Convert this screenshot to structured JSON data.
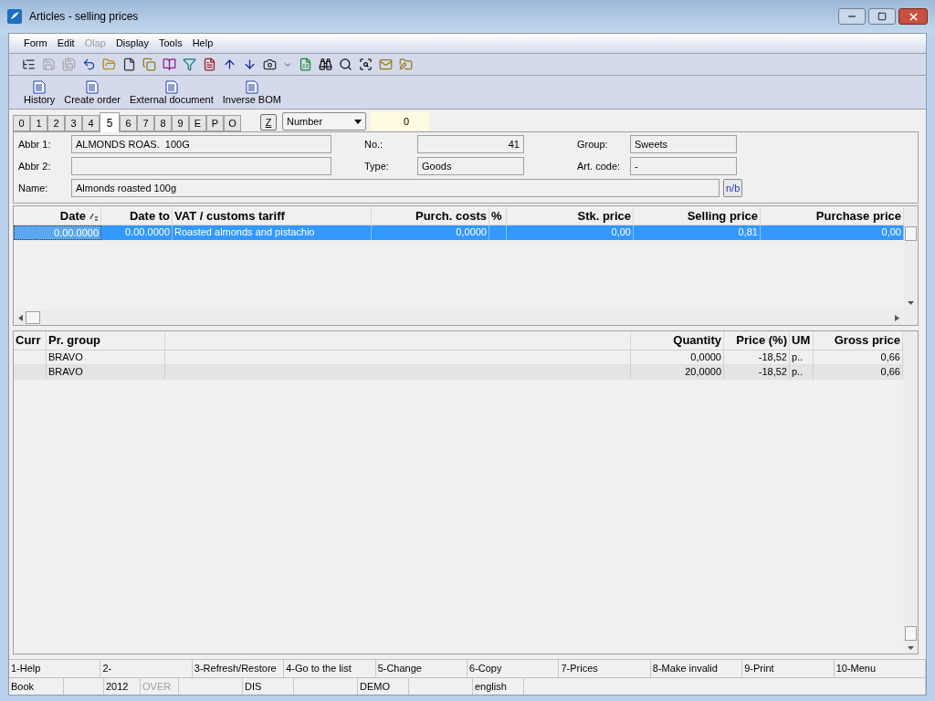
{
  "window": {
    "title": "Articles - selling prices"
  },
  "menu": [
    {
      "label": "Form",
      "disabled": false
    },
    {
      "label": "Edit",
      "disabled": false
    },
    {
      "label": "Olap",
      "disabled": true
    },
    {
      "label": "Display",
      "disabled": false
    },
    {
      "label": "Tools",
      "disabled": false
    },
    {
      "label": "Help",
      "disabled": false
    }
  ],
  "toolbar": [
    {
      "disabled": false
    },
    {
      "disabled": true
    },
    {
      "disabled": true
    },
    {
      "disabled": false
    },
    {
      "disabled": false
    },
    {
      "disabled": false
    },
    {
      "disabled": false
    },
    {
      "disabled": false
    },
    {
      "disabled": false
    },
    {
      "disabled": false
    },
    {
      "disabled": false
    },
    {
      "disabled": false
    },
    {
      "disabled": false
    },
    {
      "disabled": false
    },
    {
      "disabled": false
    },
    {
      "disabled": false
    },
    {
      "disabled": false
    },
    {
      "disabled": false
    }
  ],
  "actions": [
    "History",
    "Create order",
    "External document",
    "Inverse BOM"
  ],
  "tabs": [
    {
      "label": "0",
      "selected": false
    },
    {
      "label": "1",
      "selected": false
    },
    {
      "label": "2",
      "selected": false
    },
    {
      "label": "3",
      "selected": false
    },
    {
      "label": "4",
      "selected": false
    },
    {
      "label": "5",
      "selected": true
    },
    {
      "label": "6",
      "selected": false
    },
    {
      "label": "7",
      "selected": false
    },
    {
      "label": "8",
      "selected": false
    },
    {
      "label": "9",
      "selected": false
    },
    {
      "label": "E",
      "selected": false
    },
    {
      "label": "P",
      "selected": false
    },
    {
      "label": "O",
      "selected": false
    }
  ],
  "filter": {
    "button": "Z",
    "field": "Number",
    "value": "0"
  },
  "form": {
    "abbr1": {
      "label": "Abbr 1:",
      "value": "ALMONDS ROAS.  100G"
    },
    "abbr2": {
      "label": "Abbr 2:"
    },
    "name": {
      "label": "Name:",
      "value": "Almonds roasted 100g"
    },
    "no": {
      "label": "No.:",
      "value": "41"
    },
    "type": {
      "label": "Type:",
      "value": "Goods"
    },
    "group": {
      "label": "Group:",
      "value": "Sweets"
    },
    "art_code": {
      "label": "Art. code:",
      "value": "-"
    },
    "nb_button": "n/b"
  },
  "prices_table": {
    "columns": [
      "Date",
      "Date to",
      "VAT / customs tariff",
      "Purch. costs",
      "%",
      "Stk. price",
      "Selling price",
      "Purchase price"
    ],
    "rows": [
      {
        "selected": true,
        "cells": [
          "0.00.0000",
          "0.00.0000",
          "Roasted almonds and pistachio",
          "0,0000",
          "",
          "0,00",
          "0,81",
          "0,00"
        ]
      }
    ]
  },
  "groups_table": {
    "columns": [
      "Curr",
      "Pr. group",
      "",
      "Quantity",
      "Price (%)",
      "UM",
      "Gross price"
    ],
    "rows": [
      {
        "cells": [
          "",
          "BRAVO",
          "",
          "0,0000",
          "-18,52",
          "p..",
          "0,66"
        ]
      },
      {
        "cells": [
          "",
          "BRAVO",
          "",
          "20,0000",
          "-18,52",
          "p..",
          "0,66"
        ]
      }
    ]
  },
  "function_keys": [
    "1-Help",
    "2-",
    "3-Refresh/Restore",
    "4-Go to the list",
    "5-Change",
    "6-Copy",
    "7-Prices",
    "8-Make invalid",
    "9-Print",
    "10-Menu"
  ],
  "status_bar": [
    {
      "text": "Book",
      "disabled": false
    },
    {
      "text": "2012",
      "disabled": false
    },
    {
      "text": "OVER",
      "disabled": true
    },
    {
      "text": "DIS",
      "disabled": false
    },
    {
      "text": "DEMO",
      "disabled": false
    },
    {
      "text": "english",
      "disabled": false
    }
  ]
}
